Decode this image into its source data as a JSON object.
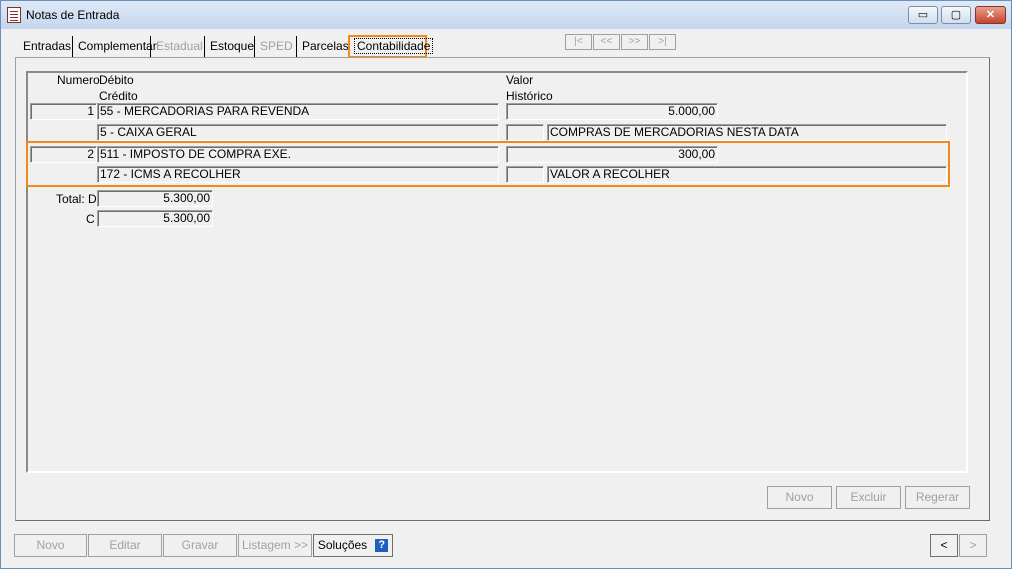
{
  "window": {
    "title": "Notas de Entrada",
    "minimize": "▭",
    "maximize": "▢",
    "close": "✕"
  },
  "tabs": [
    {
      "label": "Entradas",
      "enabled": true
    },
    {
      "label": "Complementar",
      "enabled": true
    },
    {
      "label": "Estadual",
      "enabled": false
    },
    {
      "label": "Estoque",
      "enabled": true
    },
    {
      "label": "SPED",
      "enabled": false
    },
    {
      "label": "Parcelas",
      "enabled": true
    },
    {
      "label": "Contabilidade",
      "enabled": true,
      "active": true
    }
  ],
  "record_nav": {
    "first": "|<",
    "prev": "<<",
    "next": ">>",
    "last": ">|"
  },
  "grid": {
    "headers": {
      "numero": "Numero",
      "debito": "Débito",
      "credito": "Crédito",
      "valor": "Valor",
      "historico": "Histórico"
    },
    "rows": [
      {
        "numero": "1",
        "debito": "55 - MERCADORIAS PARA REVENDA",
        "credito": "5 - CAIXA GERAL",
        "valor": "5.000,00",
        "historico_code": "",
        "historico": "COMPRAS DE MERCADORIAS NESTA DATA"
      },
      {
        "numero": "2",
        "debito": "511 - IMPOSTO DE COMPRA EXE.",
        "credito": "172 - ICMS A RECOLHER",
        "valor": "300,00",
        "historico_code": "",
        "historico": "VALOR A RECOLHER"
      }
    ],
    "totals": {
      "label_d": "Total: D",
      "value_d": "5.300,00",
      "label_c": "C",
      "value_c": "5.300,00"
    }
  },
  "panel_buttons": {
    "novo": "Novo",
    "excluir": "Excluir",
    "regerar": "Regerar"
  },
  "bottom_buttons": {
    "novo": "Novo",
    "editar": "Editar",
    "gravar": "Gravar",
    "listagem": "Listagem >>",
    "solucoes": "Soluções",
    "help": "?"
  },
  "bottom_nav": {
    "prev": "<",
    "next": ">"
  },
  "colors": {
    "highlight": "#f08a1c",
    "help_icon": "#1f5fbd"
  }
}
